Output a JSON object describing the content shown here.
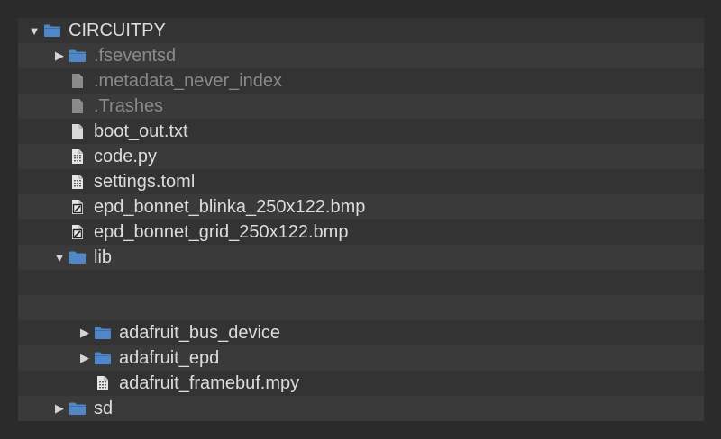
{
  "tree": {
    "rows": [
      {
        "label": "CIRCUITPY",
        "icon": "folder-icon",
        "toggle": "▼",
        "depth": 0,
        "dim": false
      },
      {
        "label": ".fseventsd",
        "icon": "folder-icon",
        "toggle": "▶",
        "depth": 1,
        "dim": true
      },
      {
        "label": ".metadata_never_index",
        "icon": "file-icon",
        "toggle": "",
        "depth": 1,
        "dim": true
      },
      {
        "label": ".Trashes",
        "icon": "file-icon",
        "toggle": "",
        "depth": 1,
        "dim": true
      },
      {
        "label": "boot_out.txt",
        "icon": "file-icon",
        "toggle": "",
        "depth": 1,
        "dim": false
      },
      {
        "label": "code.py",
        "icon": "code-file-icon",
        "toggle": "",
        "depth": 1,
        "dim": false
      },
      {
        "label": "settings.toml",
        "icon": "code-file-icon",
        "toggle": "",
        "depth": 1,
        "dim": false
      },
      {
        "label": "epd_bonnet_blinka_250x122.bmp",
        "icon": "image-file-icon",
        "toggle": "",
        "depth": 1,
        "dim": false
      },
      {
        "label": "epd_bonnet_grid_250x122.bmp",
        "icon": "image-file-icon",
        "toggle": "",
        "depth": 1,
        "dim": false
      },
      {
        "label": "lib",
        "icon": "folder-icon",
        "toggle": "▼",
        "depth": 1,
        "dim": false
      },
      {
        "label": "",
        "icon": "",
        "toggle": "",
        "depth": 2,
        "dim": false
      },
      {
        "label": "",
        "icon": "",
        "toggle": "",
        "depth": 2,
        "dim": false
      },
      {
        "label": "adafruit_bus_device",
        "icon": "folder-icon",
        "toggle": "▶",
        "depth": 2,
        "dim": false
      },
      {
        "label": "adafruit_epd",
        "icon": "folder-icon",
        "toggle": "▶",
        "depth": 2,
        "dim": false
      },
      {
        "label": "adafruit_framebuf.mpy",
        "icon": "code-file-icon",
        "toggle": "",
        "depth": 2,
        "dim": false
      },
      {
        "label": "sd",
        "icon": "folder-icon",
        "toggle": "▶",
        "depth": 1,
        "dim": false
      }
    ]
  },
  "colors": {
    "folder": "#4f87c9",
    "file": "#d8d8d8",
    "file_dim": "#8a8a8a"
  }
}
